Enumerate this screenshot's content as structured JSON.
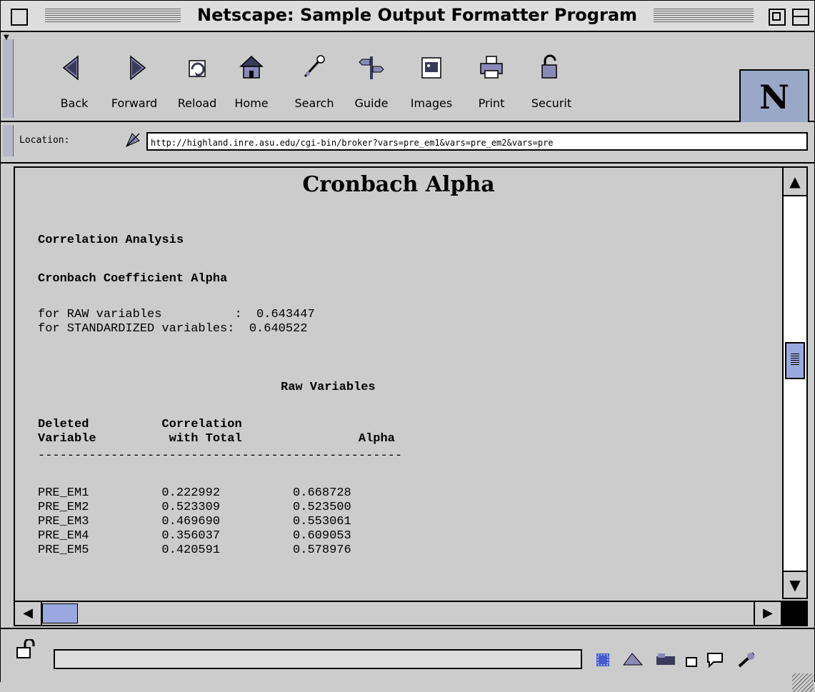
{
  "window": {
    "title": "Netscape: Sample Output Formatter Program"
  },
  "toolbar": {
    "buttons": [
      {
        "label": "Back",
        "icon": "back-arrow-icon"
      },
      {
        "label": "Forward",
        "icon": "forward-arrow-icon"
      },
      {
        "label": "Reload",
        "icon": "reload-icon"
      },
      {
        "label": "Home",
        "icon": "home-icon"
      },
      {
        "label": "Search",
        "icon": "search-icon"
      },
      {
        "label": "Guide",
        "icon": "guide-signpost-icon"
      },
      {
        "label": "Images",
        "icon": "images-icon"
      },
      {
        "label": "Print",
        "icon": "print-icon"
      },
      {
        "label": "Securit",
        "icon": "security-lock-icon"
      }
    ]
  },
  "location": {
    "label": "Location:",
    "url": "http://highland.inre.asu.edu/cgi-bin/broker?vars=pre_em1&vars=pre_em2&vars=pre"
  },
  "page": {
    "title": "Cronbach Alpha",
    "section1": "Correlation Analysis",
    "section2": "Cronbach Coefficient Alpha",
    "raw_line": "for RAW variables          :  0.643447",
    "std_line": "for STANDARDIZED variables:  0.640522",
    "raw_heading": "Raw Variables",
    "header_line1": "Deleted          Correlation",
    "header_line2": "Variable          with Total                Alpha",
    "divider": "--------------------------------------------------",
    "rows": [
      "PRE_EM1          0.222992          0.668728",
      "PRE_EM2          0.523309          0.523500",
      "PRE_EM3          0.469690          0.553061",
      "PRE_EM4          0.356037          0.609053",
      "PRE_EM5          0.420591          0.578976"
    ]
  },
  "colors": {
    "chrome": "#cccccc",
    "scroll_thumb": "#9aa8e0",
    "border": "#000000"
  }
}
